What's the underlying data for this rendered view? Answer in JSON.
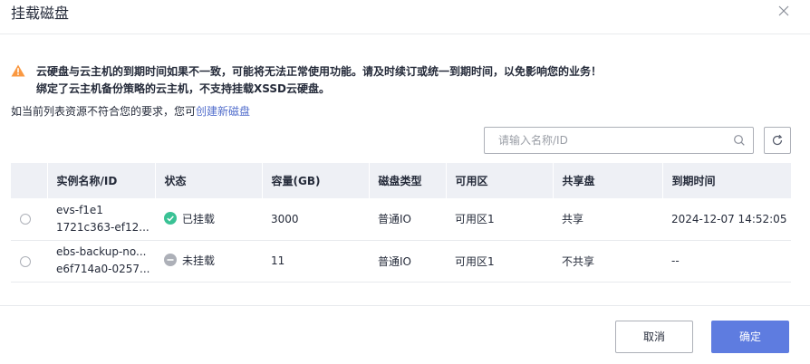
{
  "dialog": {
    "title": "挂载磁盘",
    "close_icon": "close-icon"
  },
  "warning": {
    "icon": "warning-triangle-icon",
    "color": "#fa9841",
    "line1": "云硬盘与云主机的到期时间如果不一致，可能将无法正常使用功能。请及时续订或统一到期时间，以免影响您的业务！",
    "line2": "绑定了云主机备份策略的云主机，不支持挂载XSSD云硬盘。"
  },
  "hint": {
    "text": "如当前列表资源不符合您的要求，您可",
    "link": "创建新磁盘"
  },
  "search": {
    "placeholder": "请输入名称/ID",
    "value": ""
  },
  "table": {
    "headers": [
      "实例名称/ID",
      "状态",
      "容量(GB)",
      "磁盘类型",
      "可用区",
      "共享盘",
      "到期时间"
    ],
    "rows": [
      {
        "name": "evs-f1e1",
        "id": "1721c363-ef12...",
        "status": "已挂载",
        "status_icon": "check-circle-icon",
        "status_color": "#3ac295",
        "capacity": "3000",
        "disk_type": "普通IO",
        "zone": "可用区1",
        "shared": "共享",
        "expire": "2024-12-07 14:52:05"
      },
      {
        "name": "ebs-backup-no...",
        "id": "e6f714a0-0257...",
        "status": "未挂载",
        "status_icon": "minus-circle-icon",
        "status_color": "#adb0b8",
        "capacity": "11",
        "disk_type": "普通IO",
        "zone": "可用区1",
        "shared": "不共享",
        "expire": "--"
      }
    ]
  },
  "footer": {
    "cancel_label": "取消",
    "ok_label": "确定",
    "accent": "#5e7ce0"
  }
}
